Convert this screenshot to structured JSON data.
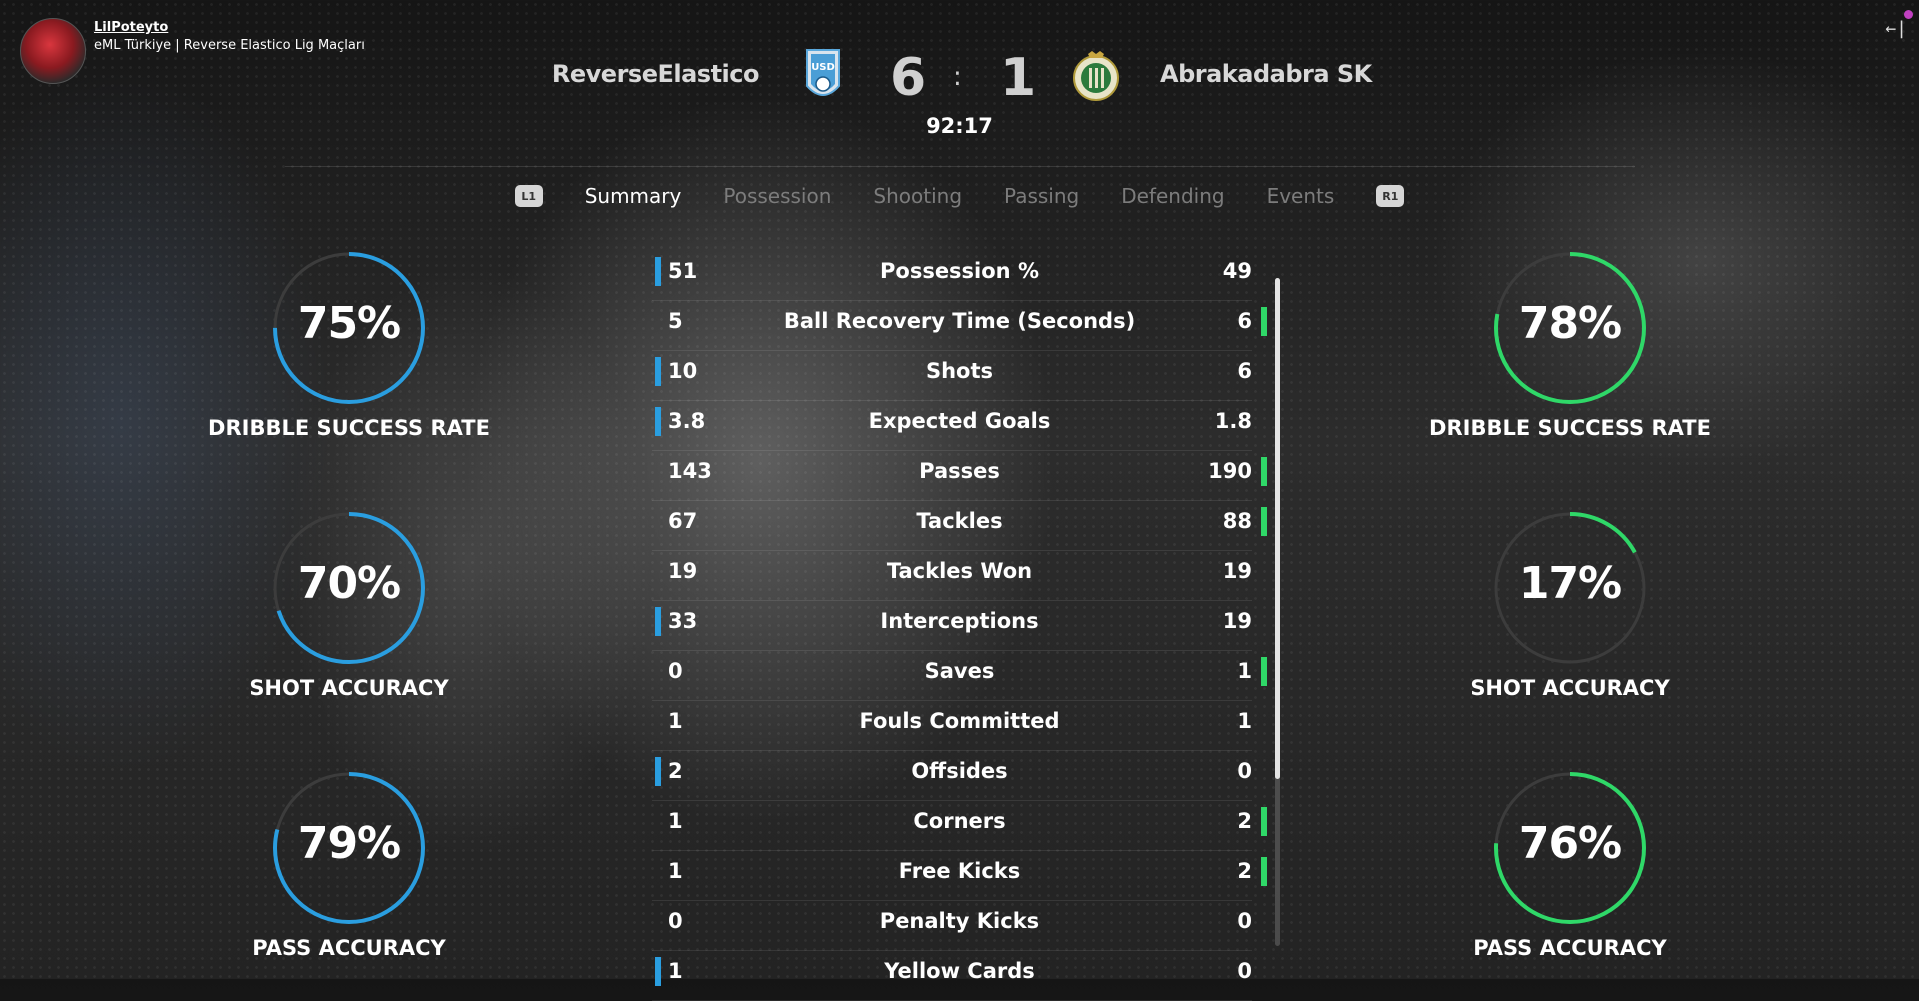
{
  "stream": {
    "username": "LilPoteyto",
    "title": "eML Türkiye | Reverse Elastico Lig Maçları",
    "exit_icon": "←|"
  },
  "match": {
    "home_team": "ReverseElastico",
    "away_team": "Abrakadabra SK",
    "home_crest_text": "USD",
    "home_score": "6",
    "separator": ":",
    "away_score": "1",
    "clock": "92:17"
  },
  "tabs": {
    "prev_button": "L1",
    "next_button": "R1",
    "items": [
      "Summary",
      "Possession",
      "Shooting",
      "Passing",
      "Defending",
      "Events"
    ],
    "active": "Summary"
  },
  "stats": [
    {
      "home": "51",
      "label": "Possession %",
      "away": "49",
      "leader": "home"
    },
    {
      "home": "5",
      "label": "Ball Recovery Time (Seconds)",
      "away": "6",
      "leader": "away"
    },
    {
      "home": "10",
      "label": "Shots",
      "away": "6",
      "leader": "home"
    },
    {
      "home": "3.8",
      "label": "Expected Goals",
      "away": "1.8",
      "leader": "home"
    },
    {
      "home": "143",
      "label": "Passes",
      "away": "190",
      "leader": "away"
    },
    {
      "home": "67",
      "label": "Tackles",
      "away": "88",
      "leader": "away"
    },
    {
      "home": "19",
      "label": "Tackles Won",
      "away": "19",
      "leader": "none"
    },
    {
      "home": "33",
      "label": "Interceptions",
      "away": "19",
      "leader": "home"
    },
    {
      "home": "0",
      "label": "Saves",
      "away": "1",
      "leader": "away"
    },
    {
      "home": "1",
      "label": "Fouls Committed",
      "away": "1",
      "leader": "none"
    },
    {
      "home": "2",
      "label": "Offsides",
      "away": "0",
      "leader": "home"
    },
    {
      "home": "1",
      "label": "Corners",
      "away": "2",
      "leader": "away"
    },
    {
      "home": "1",
      "label": "Free Kicks",
      "away": "2",
      "leader": "away"
    },
    {
      "home": "0",
      "label": "Penalty Kicks",
      "away": "0",
      "leader": "none"
    },
    {
      "home": "1",
      "label": "Yellow Cards",
      "away": "0",
      "leader": "home"
    }
  ],
  "scroll_fraction": 0.75,
  "gauges": {
    "home": [
      {
        "label": "DRIBBLE SUCCESS RATE",
        "value": 75,
        "text": "75%"
      },
      {
        "label": "SHOT ACCURACY",
        "value": 70,
        "text": "70%"
      },
      {
        "label": "PASS ACCURACY",
        "value": 79,
        "text": "79%"
      }
    ],
    "away": [
      {
        "label": "DRIBBLE SUCCESS RATE",
        "value": 78,
        "text": "78%"
      },
      {
        "label": "SHOT ACCURACY",
        "value": 17,
        "text": "17%"
      },
      {
        "label": "PASS ACCURACY",
        "value": 76,
        "text": "76%"
      }
    ]
  },
  "colors": {
    "home_accent": "#2a9ee0",
    "away_accent": "#2fd868",
    "gauge_track": "#3c3c3c"
  }
}
